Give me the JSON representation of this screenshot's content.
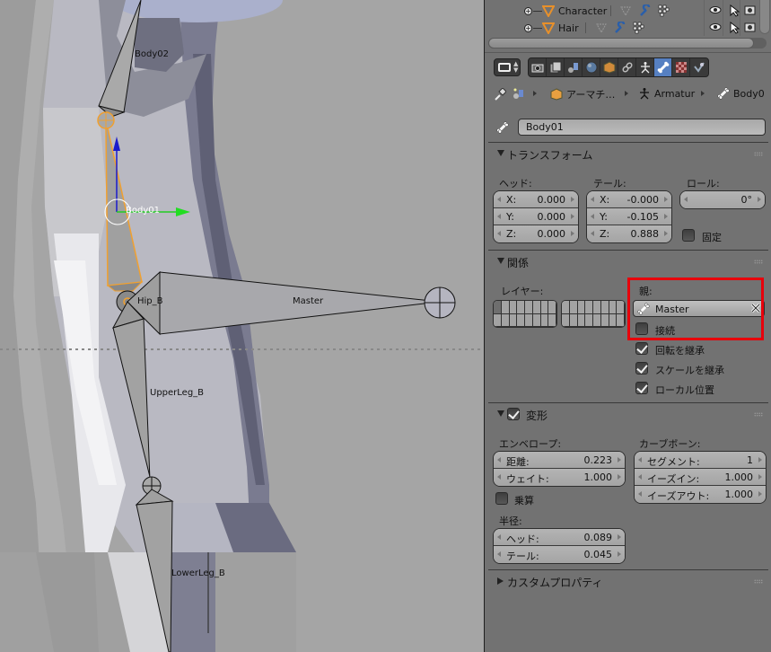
{
  "viewport": {
    "bones": [
      {
        "name": "Body02",
        "selected": false
      },
      {
        "name": "Body01",
        "selected": true
      },
      {
        "name": "Hip_B",
        "selected": false
      },
      {
        "name": "Master",
        "selected": false
      },
      {
        "name": "UpperLeg_B",
        "selected": false
      },
      {
        "name": "LowerLeg_B",
        "selected": false
      }
    ]
  },
  "outliner": {
    "rows": [
      {
        "name": "Character",
        "icon": "mesh-icon"
      },
      {
        "name": "Hair",
        "icon": "mesh-icon"
      }
    ]
  },
  "context_tabs": [
    {
      "name": "render",
      "icon": "camera-icon",
      "active": false
    },
    {
      "name": "render-layers",
      "icon": "render-layers-icon",
      "active": false
    },
    {
      "name": "scene",
      "icon": "scene-icon",
      "active": false
    },
    {
      "name": "world",
      "icon": "world-icon",
      "active": false
    },
    {
      "name": "object",
      "icon": "cube-icon",
      "active": false
    },
    {
      "name": "constraints",
      "icon": "link-icon",
      "active": false
    },
    {
      "name": "armature-data",
      "icon": "armature-icon",
      "active": false
    },
    {
      "name": "bone",
      "icon": "bone-icon",
      "active": true
    },
    {
      "name": "material",
      "icon": "checker-icon",
      "active": false
    },
    {
      "name": "bone-constraints",
      "icon": "bone-constraint-icon",
      "active": false
    }
  ],
  "breadcrumb": {
    "items": [
      "アーマチ…",
      "Armatur",
      "Body0"
    ]
  },
  "bone_name": "Body01",
  "transform": {
    "title": "トランスフォーム",
    "head_label": "ヘッド:",
    "tail_label": "テール:",
    "roll_label": "ロール:",
    "head": [
      {
        "k": "X:",
        "v": "0.000"
      },
      {
        "k": "Y:",
        "v": "0.000"
      },
      {
        "k": "Z:",
        "v": "0.000"
      }
    ],
    "tail": [
      {
        "k": "X:",
        "v": "-0.000"
      },
      {
        "k": "Y:",
        "v": "-0.105"
      },
      {
        "k": "Z:",
        "v": "0.888"
      }
    ],
    "roll": "0°",
    "lock_label": "固定",
    "lock_checked": false
  },
  "relations": {
    "title": "関係",
    "layers_label": "レイヤー:",
    "parent_label": "親:",
    "parent_value": "Master",
    "connected_label": "接続",
    "connected_checked": false,
    "inherit_rotation_label": "回転を継承",
    "inherit_rotation_checked": true,
    "inherit_scale_label": "スケールを継承",
    "inherit_scale_checked": true,
    "local_location_label": "ローカル位置",
    "local_location_checked": true
  },
  "deform": {
    "title": "変形",
    "enabled": true,
    "envelope_label": "エンベロープ:",
    "envelope": [
      {
        "k": "距離:",
        "v": "0.223"
      },
      {
        "k": "ウェイト:",
        "v": "1.000"
      }
    ],
    "multiply_label": "乗算",
    "multiply_checked": false,
    "curved_label": "カーブボーン:",
    "curved": [
      {
        "k": "セグメント:",
        "v": "1"
      },
      {
        "k": "イーズイン:",
        "v": "1.000"
      },
      {
        "k": "イーズアウト:",
        "v": "1.000"
      }
    ],
    "radius_label": "半径:",
    "radius": [
      {
        "k": "ヘッド:",
        "v": "0.089"
      },
      {
        "k": "テール:",
        "v": "0.045"
      }
    ]
  },
  "custom_properties": {
    "title": "カスタムプロパティ"
  },
  "colors": {
    "selection": "#f0a030",
    "active_tab": "#5680c2",
    "highlight": "#e8000b"
  }
}
